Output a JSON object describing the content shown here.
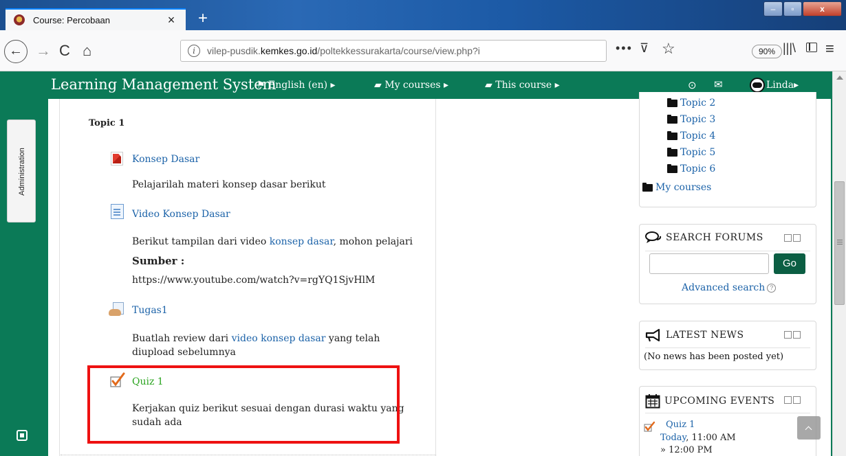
{
  "browser": {
    "tab_title": "Course: Percobaan",
    "tab_close": "×",
    "new_tab": "+",
    "url_domain_prefix": "vilep-pusdik.",
    "url_domain": "kemkes.go.id",
    "url_path": "/poltekkessurakarta/course/view.php?i",
    "zoom": "90%",
    "page_actions": "•••",
    "pocket": "⊽",
    "star": "☆",
    "library": "|||\\",
    "menu": "≡",
    "back": "←",
    "forward": "→",
    "reload": "C",
    "home": "⌂",
    "info": "i",
    "win_min": "–",
    "win_max": "▫",
    "win_close": "x"
  },
  "moodle_nav": {
    "brand": "Learning Management System",
    "language": "English (en)",
    "my_courses": "My courses",
    "this_course": "This course",
    "user": "Linda",
    "lang_icon": "⚑",
    "courses_icon": "▰",
    "course_icon": "▰",
    "caret": "▸",
    "target_icon": "⊙",
    "mail_icon": "✉"
  },
  "sidebar": {
    "administration": "Administration"
  },
  "topic": {
    "title": "Topic 1",
    "activities": [
      {
        "name": "Konsep Dasar",
        "description": "Pelajarilah materi konsep dasar berikut",
        "icon": "pdf-icon"
      },
      {
        "name": "Video Konsep Dasar",
        "description_pre": "Berikut tampilan dari video ",
        "description_link": "konsep dasar",
        "description_post": ", mohon pelajari",
        "source_label": "Sumber :",
        "source_url": "https://www.youtube.com/watch?v=rgYQ1SjvHlM",
        "icon": "page-icon"
      },
      {
        "name": "Tugas1",
        "description_pre": "Buatlah review dari ",
        "description_link1": "video",
        "description_space": " ",
        "description_link2": "konsep dasar",
        "description_post": " yang telah",
        "description_line2": "diupload sebelumnya",
        "icon": "assignment-icon"
      },
      {
        "name": "Quiz 1",
        "description_line1": "Kerjakan quiz berikut sesuai dengan durasi waktu yang",
        "description_line2": "sudah ada",
        "icon": "quiz-icon"
      }
    ]
  },
  "navigation_block": {
    "items": [
      "Topic 2",
      "Topic 3",
      "Topic 4",
      "Topic 5",
      "Topic 6"
    ],
    "my_courses": "My courses"
  },
  "search_forums": {
    "title": "SEARCH FORUMS",
    "button": "Go",
    "advanced": "Advanced search",
    "help": "?"
  },
  "latest_news": {
    "title": "LATEST NEWS",
    "empty": "(No news has been posted yet)"
  },
  "upcoming_events": {
    "title": "UPCOMING EVENTS",
    "event_name": "Quiz 1",
    "event_day": "Today",
    "event_time": ", 11:00 AM",
    "event_end": "» 12:00 PM"
  },
  "colors": {
    "moodle_green": "#0b7a57",
    "link_blue": "#1b62a8",
    "quiz_green": "#2aa41f",
    "highlight_red": "#ee1111"
  }
}
